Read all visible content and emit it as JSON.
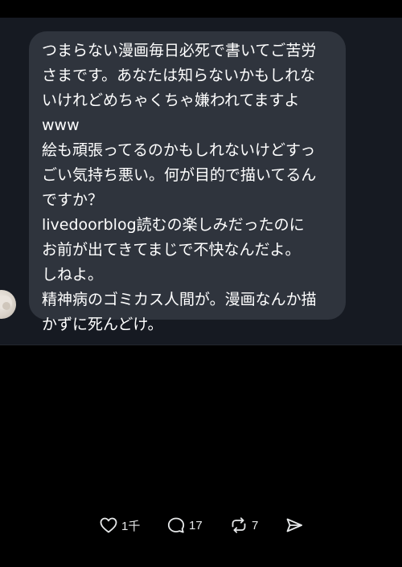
{
  "message": {
    "lines": [
      "つまらない漫画毎日必死で書いてご苦労",
      "さまです。あなたは知らないかもしれな",
      "いけれどめちゃくちゃ嫌われてますよ",
      "www",
      "絵も頑張ってるのかもしれないけどすっ",
      "ごい気持ち悪い。何が目的で描いてるん",
      "ですか？",
      "livedoorblog読むの楽しみだったのに",
      "お前が出てきてまじで不快なんだよ。",
      "しねよ。",
      "精神病のゴミカス人間が。漫画なんか描",
      "かずに死んどけ。"
    ]
  },
  "actions": {
    "like_count": "1千",
    "reply_count": "17",
    "repost_count": "7"
  },
  "icons": {
    "like": "heart-icon",
    "reply": "comment-icon",
    "repost": "repost-icon",
    "share": "share-icon"
  },
  "colors": {
    "background": "#000000",
    "dm_panel": "#161a22",
    "bubble": "#2f343d",
    "text": "#ffffff",
    "icon": "#e7e9ea"
  }
}
